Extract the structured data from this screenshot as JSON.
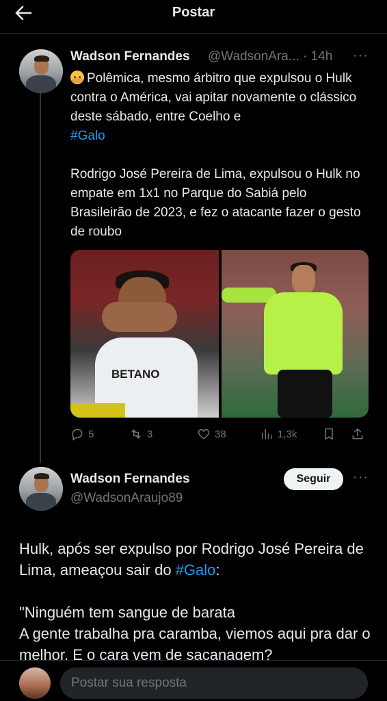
{
  "header": {
    "title": "Postar",
    "back_icon": "arrow-left-icon"
  },
  "quoted_tweet": {
    "author_name": "Wadson Fernandes",
    "author_handle": "@WadsonAra...",
    "separator": "·",
    "time": "14h",
    "paragraph1_after_emoji": "Polêmica, mesmo árbitro que expulsou o Hulk contra o América, vai apitar novamente o clássico deste sábado, entre Coelho e",
    "hashtag": "#Galo",
    "paragraph2": "Rodrigo José Pereira de Lima, expulsou o Hulk no empate em 1x1 no Parque do Sabiá pelo Brasileirão de 2023, e fez o atacante fazer o gesto de roubo",
    "image_left_sponsor": "BETANO",
    "actions": {
      "replies": "5",
      "retweets": "3",
      "likes": "38",
      "views": "1,3k"
    }
  },
  "main_tweet": {
    "author_name": "Wadson Fernandes",
    "author_handle": "@WadsonAraujo89",
    "follow_label": "Seguir",
    "line1": "Hulk, após ser expulso por Rodrigo José Pereira de Lima, ameaçou sair do",
    "hashtag": "#Galo",
    "line1_end": ":",
    "line2": "\"Ninguém tem sangue de barata\nA gente trabalha pra caramba, viemos aqui pra dar o melhor. E o cara vem de sacanagem?"
  },
  "reply": {
    "placeholder": "Postar sua resposta"
  },
  "colors": {
    "accent": "#1d9bf0",
    "muted": "#71767b",
    "text": "#e7e9ea",
    "background": "#000000"
  }
}
